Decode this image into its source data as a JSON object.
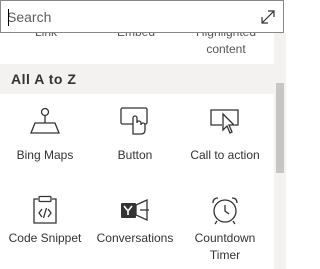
{
  "search": {
    "placeholder": "Search",
    "expand_icon": "expand-diagonal-icon"
  },
  "partial_row": [
    {
      "label": "Link"
    },
    {
      "label": "Embed"
    },
    {
      "label": "Highlighted content"
    }
  ],
  "section": {
    "title": "All A to Z"
  },
  "tiles": [
    {
      "label": "Bing Maps",
      "icon": "map-pin-icon"
    },
    {
      "label": "Button",
      "icon": "button-click-icon"
    },
    {
      "label": "Call to action",
      "icon": "call-to-action-icon"
    },
    {
      "label": "Code Snippet",
      "icon": "code-snippet-icon"
    },
    {
      "label": "Conversations",
      "icon": "yammer-conversations-icon"
    },
    {
      "label": "Countdown Timer",
      "icon": "alarm-clock-icon"
    }
  ],
  "colors": {
    "icon_stroke": "#333333",
    "section_bg": "#f3f2f1",
    "scroll_thumb": "#c8c6c4"
  }
}
